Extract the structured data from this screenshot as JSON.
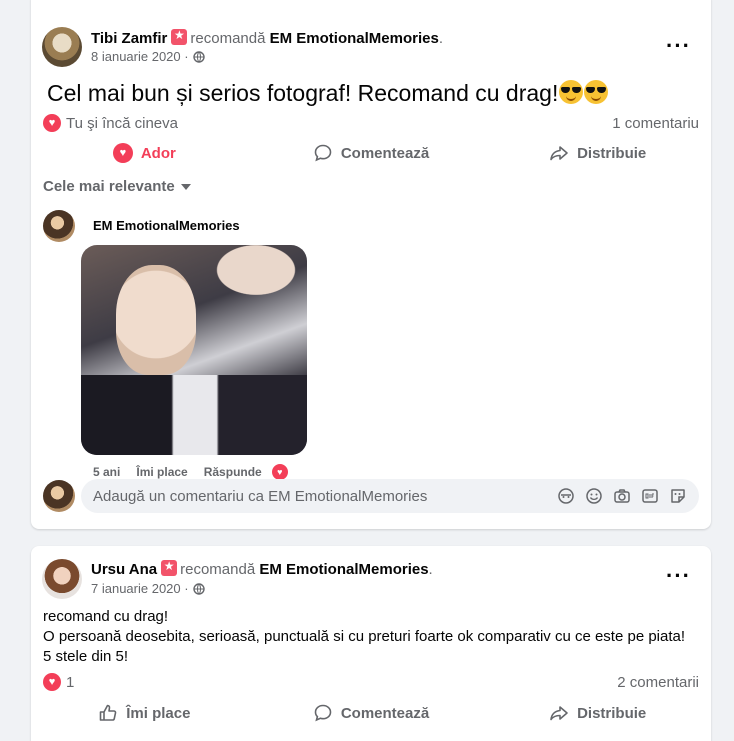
{
  "post1": {
    "author": "Tibi Zamfir",
    "verb": "recomandă",
    "page": "EM EmotionalMemories",
    "period": ".",
    "date": "8 ianuarie 2020 ·",
    "more": "···",
    "text": "Cel mai bun și serios fotograf! Recomand cu drag!",
    "reactions_text": "Tu şi încă cineva",
    "comments_count": "1 comentariu",
    "actions": {
      "like": "Ador",
      "comment": "Comentează",
      "share": "Distribuie"
    },
    "sort_label": "Cele mai relevante",
    "comment": {
      "author": "EM EmotionalMemories",
      "age": "5 ani",
      "like": "Îmi place",
      "reply": "Răspunde"
    },
    "composer_placeholder": "Adaugă un comentariu ca EM EmotionalMemories"
  },
  "post2": {
    "author": "Ursu Ana",
    "verb": "recomandă",
    "page": "EM EmotionalMemories",
    "period": ".",
    "date": "7 ianuarie 2020 ·",
    "more": "···",
    "lines": [
      "recomand cu drag!",
      "O persoană deosebita, serioasă, punctuală si cu preturi foarte ok comparativ cu ce este pe piata!",
      "5 stele din 5!"
    ],
    "reaction_count": "1",
    "comments_count": "2 comentarii",
    "actions": {
      "like": "Îmi place",
      "comment": "Comentează",
      "share": "Distribuie"
    }
  },
  "colors": {
    "accent_red": "#f33e58",
    "muted": "#65676b",
    "background": "#f0f2f5"
  },
  "icons": [
    "globe-icon",
    "heart-icon",
    "comment-icon",
    "share-icon",
    "like-icon",
    "sticker-icon",
    "emoji-icon",
    "camera-icon",
    "gif-icon",
    "more-icon"
  ]
}
